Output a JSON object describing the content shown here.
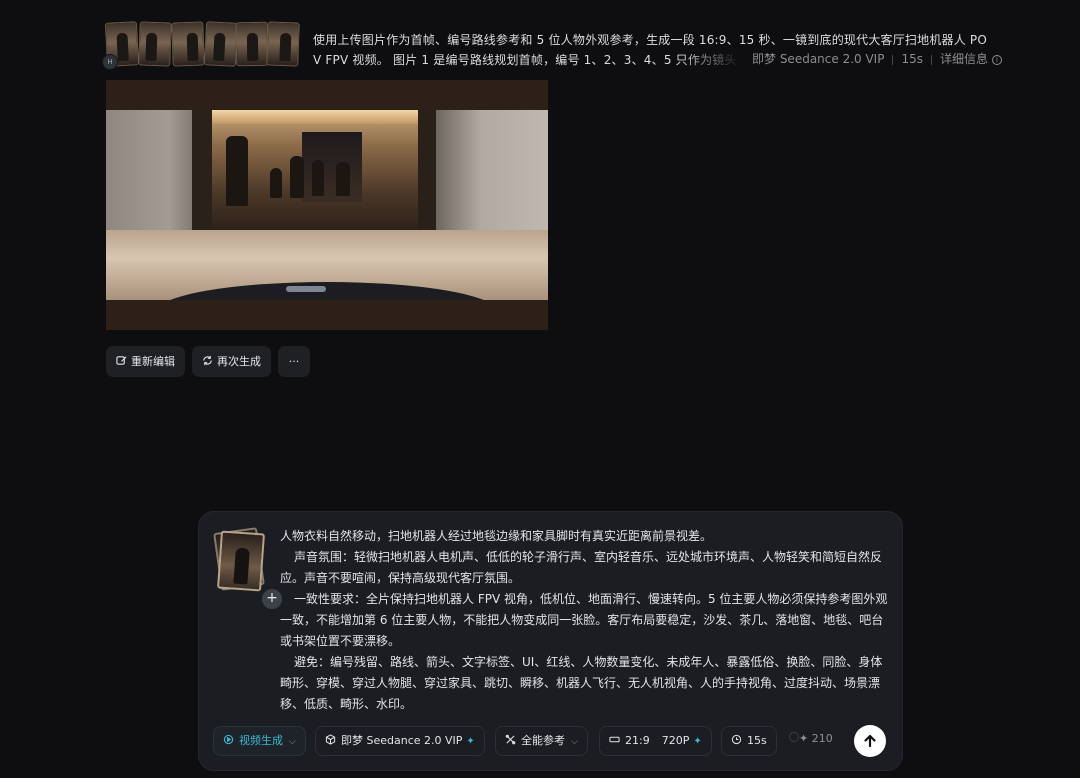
{
  "header": {
    "reference_count_badge": "H",
    "prompt_line1": "使用上传图片作为首帧、编号路线参考和 5 位人物外观参考，生成一段 16:9、15 秒、一镜到底的现代大客厅扫地机器人 PO",
    "prompt_line2": "V FPV 视频。 图片 1 是编号路线规划首帧，编号 1、2、3、4、5 只作为镜头",
    "model_name": "即梦 Seedance 2.0 VIP",
    "duration": "15s",
    "details_label": "详细信息"
  },
  "actions": {
    "reedit_label": "重新编辑",
    "regenerate_label": "再次生成",
    "more_label": "···"
  },
  "composer": {
    "add_label": "+",
    "paragraphs": [
      "人物衣料自然移动，扫地机器人经过地毯边缘和家具脚时有真实近距离前景视差。",
      "声音氛围：轻微扫地机器人电机声、低低的轮子滑行声、室内轻音乐、远处城市环境声、人物轻笑和简短自然反应。声音不要喧闹，保持高级现代客厅氛围。",
      "一致性要求：全片保持扫地机器人 FPV 视角，低机位、地面滑行、慢速转向。5 位主要人物必须保持参考图外观一致，不能增加第 6 位主要人物，不能把人物变成同一张脸。客厅布局要稳定，沙发、茶几、落地窗、地毯、吧台或书架位置不要漂移。",
      "避免：编号残留、路线、箭头、文字标签、UI、红线、人物数量变化、未成年人、暴露低俗、换脸、同脸、身体畸形、穿模、穿过人物腿、穿过家具、跳切、瞬移、机器人飞行、无人机视角、人的手持视角、过度抖动、场景漂移、低质、畸形、水印。"
    ],
    "toolbar": {
      "mode_label": "视频生成",
      "model_label": "即梦 Seedance 2.0 VIP",
      "reference_label": "全能参考",
      "ratio_label": "21:9",
      "resolution_label": "720P",
      "duration_label": "15s",
      "credits_label": "✦ 210"
    }
  },
  "colors": {
    "background": "#0e0e10",
    "panel": "#1b1d22",
    "accent": "#3bb7d3"
  }
}
